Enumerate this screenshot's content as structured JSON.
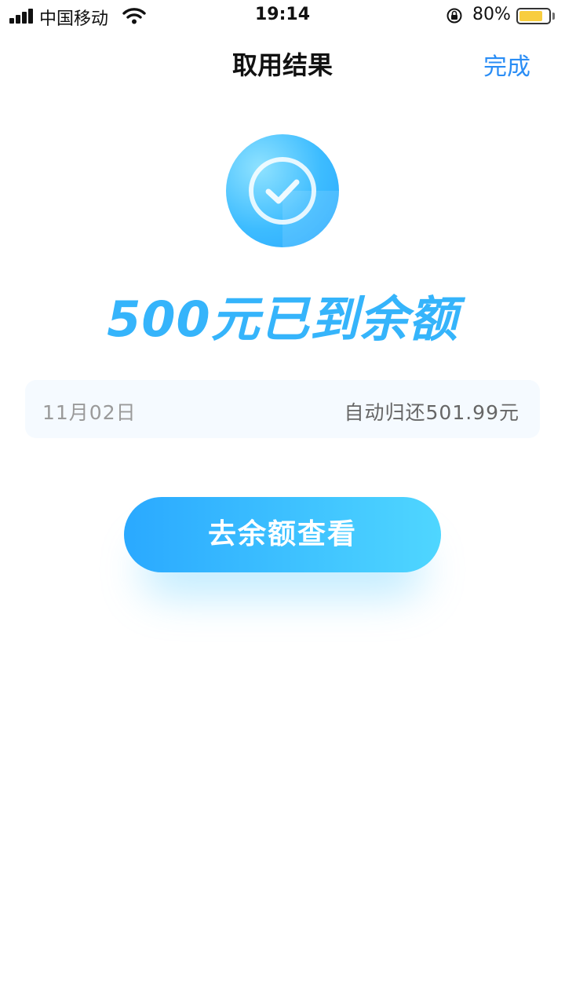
{
  "status_bar": {
    "carrier": "中国移动",
    "time": "19:14",
    "battery_percent": "80%",
    "battery_level": 0.8,
    "battery_color": "#f7c51e"
  },
  "nav": {
    "title": "取用结果",
    "done_label": "完成",
    "accent_color": "#2a8df5"
  },
  "result": {
    "icon": "check-circle-icon",
    "headline": "500元已到余额"
  },
  "info": {
    "date": "11月02日",
    "repay_text": "自动归还501.99元"
  },
  "action": {
    "button_label": "去余额查看"
  }
}
